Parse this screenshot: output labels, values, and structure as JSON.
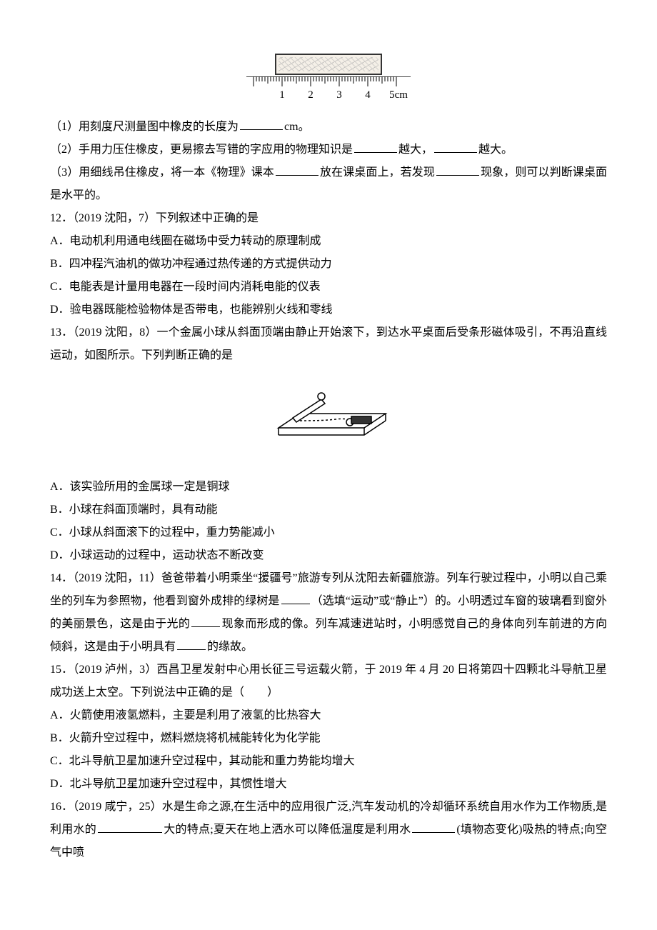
{
  "ruler_labels": [
    "1",
    "2",
    "3",
    "4",
    "5cm"
  ],
  "q11": {
    "p1_a": "（1）用刻度尺测量图中橡皮的长度为",
    "p1_b": "cm。",
    "p2_a": "（2）手用力压住橡皮，更易擦去写错的字应用的物理知识是",
    "p2_b": "越大，",
    "p2_c": "越大。",
    "p3_a": "（3）用细线吊住橡皮，将一本《物理》课本",
    "p3_b": "放在课桌面上，若发现",
    "p3_c": "现象，则可以判断课桌面是水平的。"
  },
  "q12": {
    "stem": "12．（2019 沈阳，7）下列叙述中正确的是",
    "A": "A．电动机利用通电线圈在磁场中受力转动的原理制成",
    "B": "B．四冲程汽油机的做功冲程通过热传递的方式提供动力",
    "C": "C．电能表是计量用电器在一段时间内消耗电能的仪表",
    "D": "D．验电器既能检验物体是否带电，也能辨别火线和零线"
  },
  "q13": {
    "stem": "13．（2019 沈阳，8）一个金属小球从斜面顶端由静止开始滚下，到达水平桌面后受条形磁体吸引，不再沿直线运动，如图所示。下列判断正确的是",
    "A": "A．该实验所用的金属球一定是铜球",
    "B": "B．小球在斜面顶端时，具有动能",
    "C": "C．小球从斜面滚下的过程中，重力势能减小",
    "D": "D．小球运动的过程中，运动状态不断改变"
  },
  "q14": {
    "a": "14．（2019 沈阳，11）爸爸带着小明乘坐“援疆号”旅游专列从沈阳去新疆旅游。列车行驶过程中，小明以自己乘坐的列车为参照物，他看到窗外成排的绿树是",
    "b": "（选填“运动”或“静止”）的。小明透过车窗的玻璃看到窗外的美丽景色，这是由于光的",
    "c": "现象而形成的像。列车减速进站时，小明感觉自己的身体向列车前进的方向倾斜，这是由于小明具有",
    "d": "的缘故。"
  },
  "q15": {
    "stem": "15．（2019 泸州，3）西昌卫星发射中心用长征三号运载火箭，于 2019 年 4 月 20 日将第四十四颗北斗导航卫星成功送上太空。下列说法中正确的是（　　）",
    "A": "A．火箭使用液氢燃料，主要是利用了液氢的比热容大",
    "B": "B．火箭升空过程中，燃料燃烧将机械能转化为化学能",
    "C": "C．北斗导航卫星加速升空过程中，其动能和重力势能均增大",
    "D": "D．北斗导航卫星加速升空过程中，其惯性增大"
  },
  "q16": {
    "a": "16．（2019 咸宁，25）水是生命之源,在生活中的应用很广泛,汽车发动机的冷却循环系统自用水作为工作物质,是利用水的",
    "b": "大的特点;夏天在地上洒水可以降低温度是利用水",
    "c": "(填物态变化)吸热的特点;向空气中喷"
  }
}
